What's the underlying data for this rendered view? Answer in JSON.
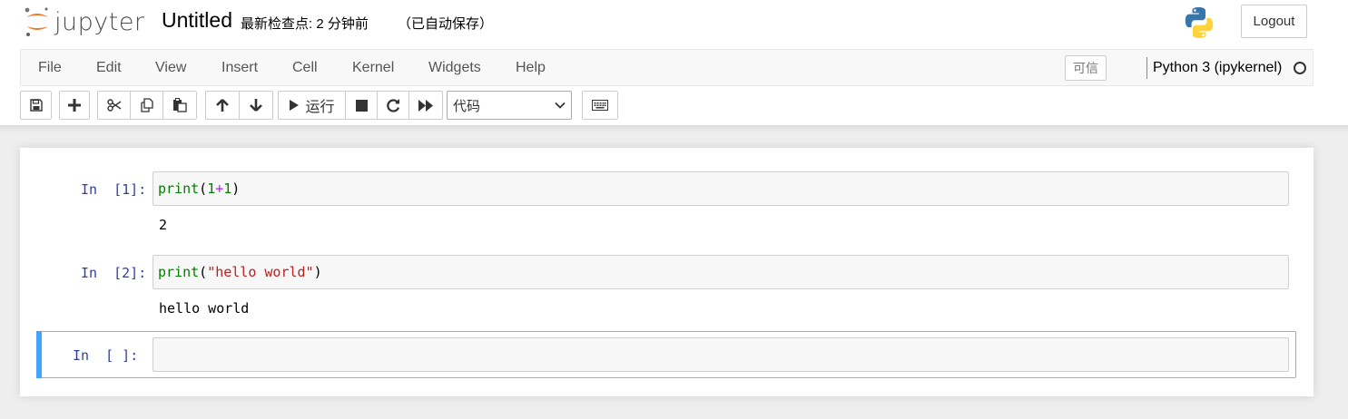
{
  "header": {
    "logo_text": "jupyter",
    "notebook_name": "Untitled",
    "checkpoint": "最新检查点: 2 分钟前",
    "autosave": "（已自动保存）",
    "logout_label": "Logout"
  },
  "menubar": {
    "items": [
      "File",
      "Edit",
      "View",
      "Insert",
      "Cell",
      "Kernel",
      "Widgets",
      "Help"
    ],
    "trusted_label": "可信",
    "kernel_name": "Python 3 (ipykernel)"
  },
  "toolbar": {
    "buttons": [
      "save-icon",
      "plus-icon",
      "cut-icon",
      "copy-icon",
      "paste-icon",
      "arrow-up-icon",
      "arrow-down-icon",
      "play-icon",
      "stop-icon",
      "refresh-icon",
      "fast-forward-icon",
      "keyboard-icon"
    ],
    "run_label": "运行",
    "cell_type_selected": "代码"
  },
  "cells": [
    {
      "prompt": "In  [1]:",
      "code_fn": "print",
      "code_open": "(",
      "code_a": "1",
      "code_op": "+",
      "code_b": "1",
      "code_close": ")",
      "output": "2"
    },
    {
      "prompt": "In  [2]:",
      "code_fn": "print",
      "code_open": "(",
      "code_str": "\"hello world\"",
      "code_close": ")",
      "output": "hello world"
    },
    {
      "prompt": "In  [ ]:",
      "code": ""
    }
  ],
  "colors": {
    "prompt": "#303f9f",
    "selected_bar": "#42a5f5",
    "jupyter_orange": "#f37626",
    "builtin_green": "#008000",
    "string_red": "#ba2121",
    "operator_purple": "#aa22ff"
  }
}
